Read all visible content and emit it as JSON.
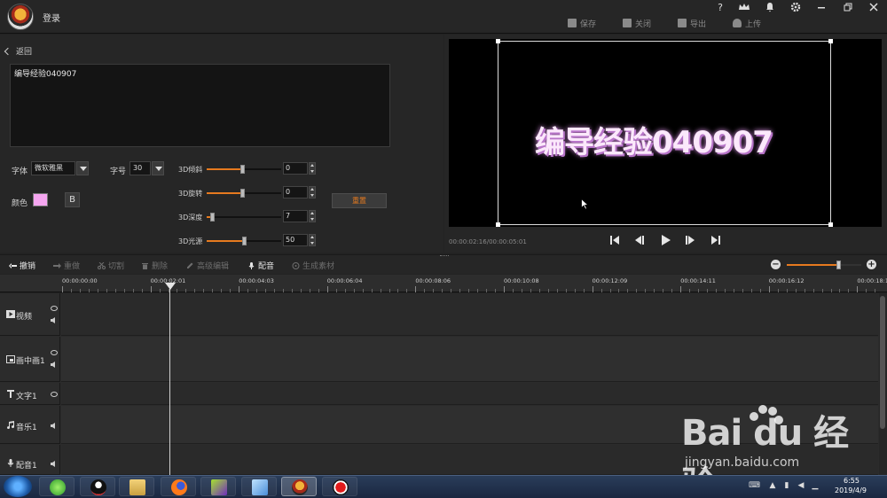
{
  "header": {
    "login_label": "登录",
    "actions": {
      "save": "保存",
      "close": "关闭",
      "export": "导出",
      "upload": "上传"
    },
    "system": {
      "help": "?",
      "vip": "VIP"
    }
  },
  "editor": {
    "back_label": "返回",
    "text_value": "编导经验040907",
    "font_label": "字体",
    "font_value": "微软雅黑",
    "size_label": "字号",
    "size_value": "30",
    "color_label": "颜色",
    "color_value": "#f5a6f0",
    "bold_label": "B",
    "reset_label": "重置",
    "sliders": [
      {
        "label": "3D倾斜",
        "value": "0",
        "fraction": 0.48
      },
      {
        "label": "3D旋转",
        "value": "0",
        "fraction": 0.48
      },
      {
        "label": "3D深度",
        "value": "7",
        "fraction": 0.07
      },
      {
        "label": "3D光源",
        "value": "50",
        "fraction": 0.5
      }
    ]
  },
  "preview": {
    "text": "编导经验040907",
    "timecode": "00:00:02:16/00:00:05:01"
  },
  "timeline": {
    "tools": {
      "undo": "撤销",
      "redo": "重做",
      "cut": "切割",
      "delete": "删除",
      "advanced": "高级编辑",
      "dub": "配音",
      "generate": "生成素材"
    },
    "ruler": [
      "00:00:00:00",
      "00:00:02:01",
      "00:00:04:03",
      "00:00:06:04",
      "00:00:08:06",
      "00:00:10:08",
      "00:00:12:09",
      "00:00:14:11",
      "00:00:16:12",
      "00:00:18:1"
    ],
    "tracks": [
      {
        "name": "视频"
      },
      {
        "name": "画中画1"
      },
      {
        "name": "文字1"
      },
      {
        "name": "音乐1"
      },
      {
        "name": "配音1"
      }
    ],
    "zoom_fraction": 0.7
  },
  "taskbar": {
    "time": "6:55",
    "date": "2019/4/9"
  },
  "watermark": {
    "logo": "Bai  du 经验",
    "url": "jingyan.baidu.com"
  },
  "colors": {
    "accent": "#e67a1f",
    "text_color": "#f5a6f0"
  }
}
